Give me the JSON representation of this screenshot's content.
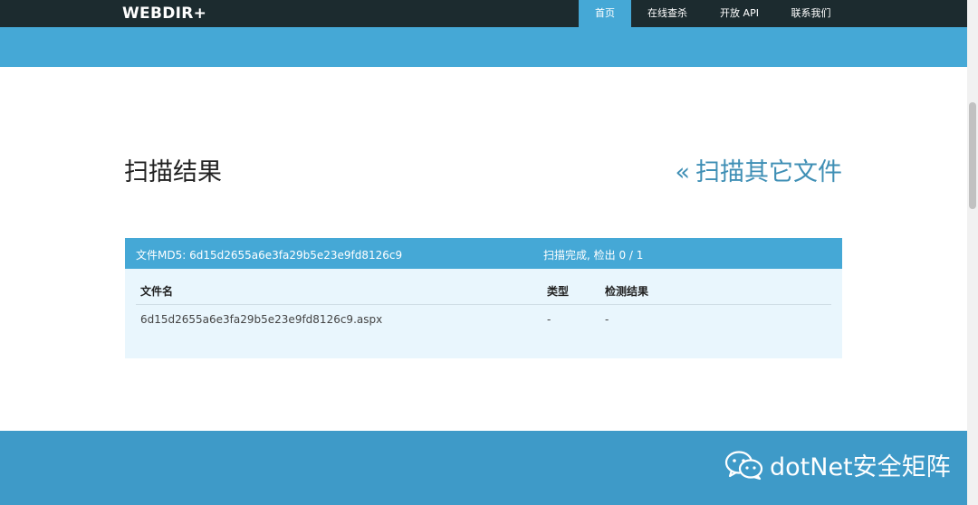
{
  "header": {
    "brand": "WEBDIR+",
    "nav": [
      {
        "label": "首页",
        "active": true
      },
      {
        "label": "在线查杀",
        "active": false
      },
      {
        "label": "开放 API",
        "active": false
      },
      {
        "label": "联系我们",
        "active": false
      }
    ]
  },
  "main": {
    "title": "扫描结果",
    "back_chevron": "«",
    "back_link": "扫描其它文件",
    "result": {
      "md5_line": "文件MD5: 6d15d2655a6e3fa29b5e23e9fd8126c9",
      "status_line": "扫描完成, 检出 0 / 1",
      "columns": [
        "文件名",
        "类型",
        "检测结果"
      ],
      "rows": [
        [
          "6d15d2655a6e3fa29b5e23e9fd8126c9.aspx",
          "-",
          "-"
        ]
      ]
    }
  },
  "footer": {
    "watermark_text": "dotNet安全矩阵",
    "watermark_icon": "wechat-icon"
  },
  "colors": {
    "nav_bg": "#1c2b2f",
    "accent": "#45a8d6",
    "footer_bg": "#3e9ac8",
    "panel_bg": "#e9f6fd",
    "link": "#3f8fb5"
  }
}
